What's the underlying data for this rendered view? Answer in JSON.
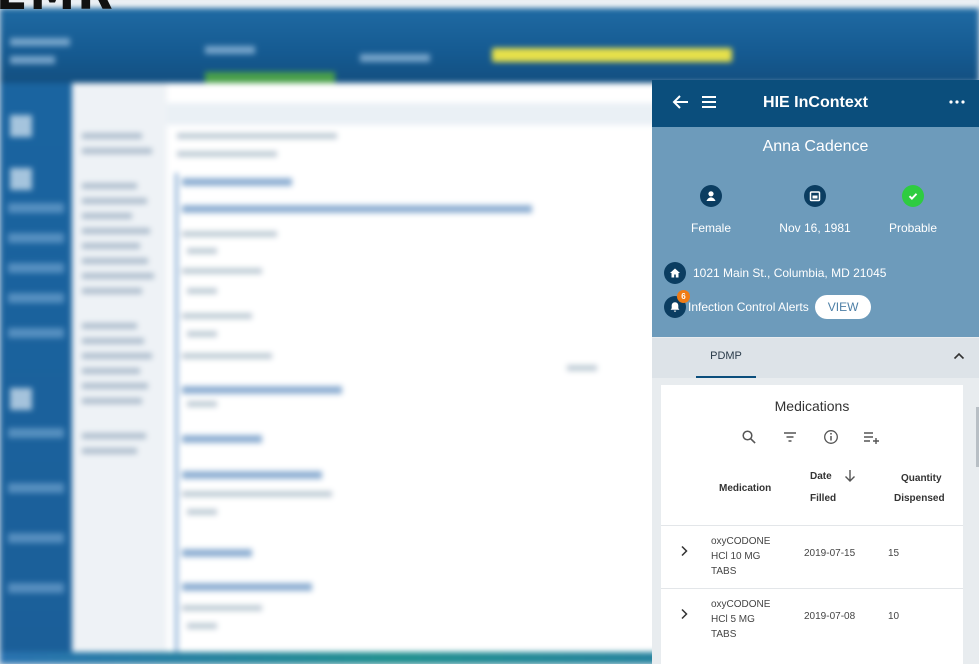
{
  "app": {
    "title": "HIE InContext",
    "corner_text": "EMR"
  },
  "toolbar": {
    "back_icon": "arrow-left-icon",
    "menu_icon": "hamburger-menu-icon",
    "more_icon": "more-horizontal-icon"
  },
  "patient": {
    "name": "Anna Cadence",
    "gender": "Female",
    "dob": "Nov 16, 1981",
    "match": "Probable",
    "address": "1021 Main St., Columbia, MD 21045",
    "alerts_label": "Infection Control Alerts",
    "alerts_count": "6",
    "view_button": "VIEW",
    "match_color": "#2ecc40"
  },
  "tabs": [
    {
      "label": "PDMP",
      "selected": true
    }
  ],
  "medications": {
    "title": "Medications",
    "tool_icons": [
      "search-icon",
      "filter-icon",
      "info-icon",
      "add-list-icon"
    ],
    "columns": {
      "medication": "Medication",
      "date_filled_1": "Date",
      "date_filled_2": "Filled",
      "quantity_1": "Quantity",
      "quantity_2": "Dispensed"
    },
    "rows": [
      {
        "med_1": "oxyCODONE",
        "med_2": "HCl 10 MG",
        "med_3": "TABS",
        "date": "2019-07-15",
        "qty": "15"
      },
      {
        "med_1": "oxyCODONE",
        "med_2": "HCl 5 MG",
        "med_3": "TABS",
        "date": "2019-07-08",
        "qty": "10"
      }
    ]
  },
  "colors": {
    "topbar": "#0b4e7c",
    "patient_header": "#6d9bbb",
    "alert_badge": "#f07c16"
  }
}
